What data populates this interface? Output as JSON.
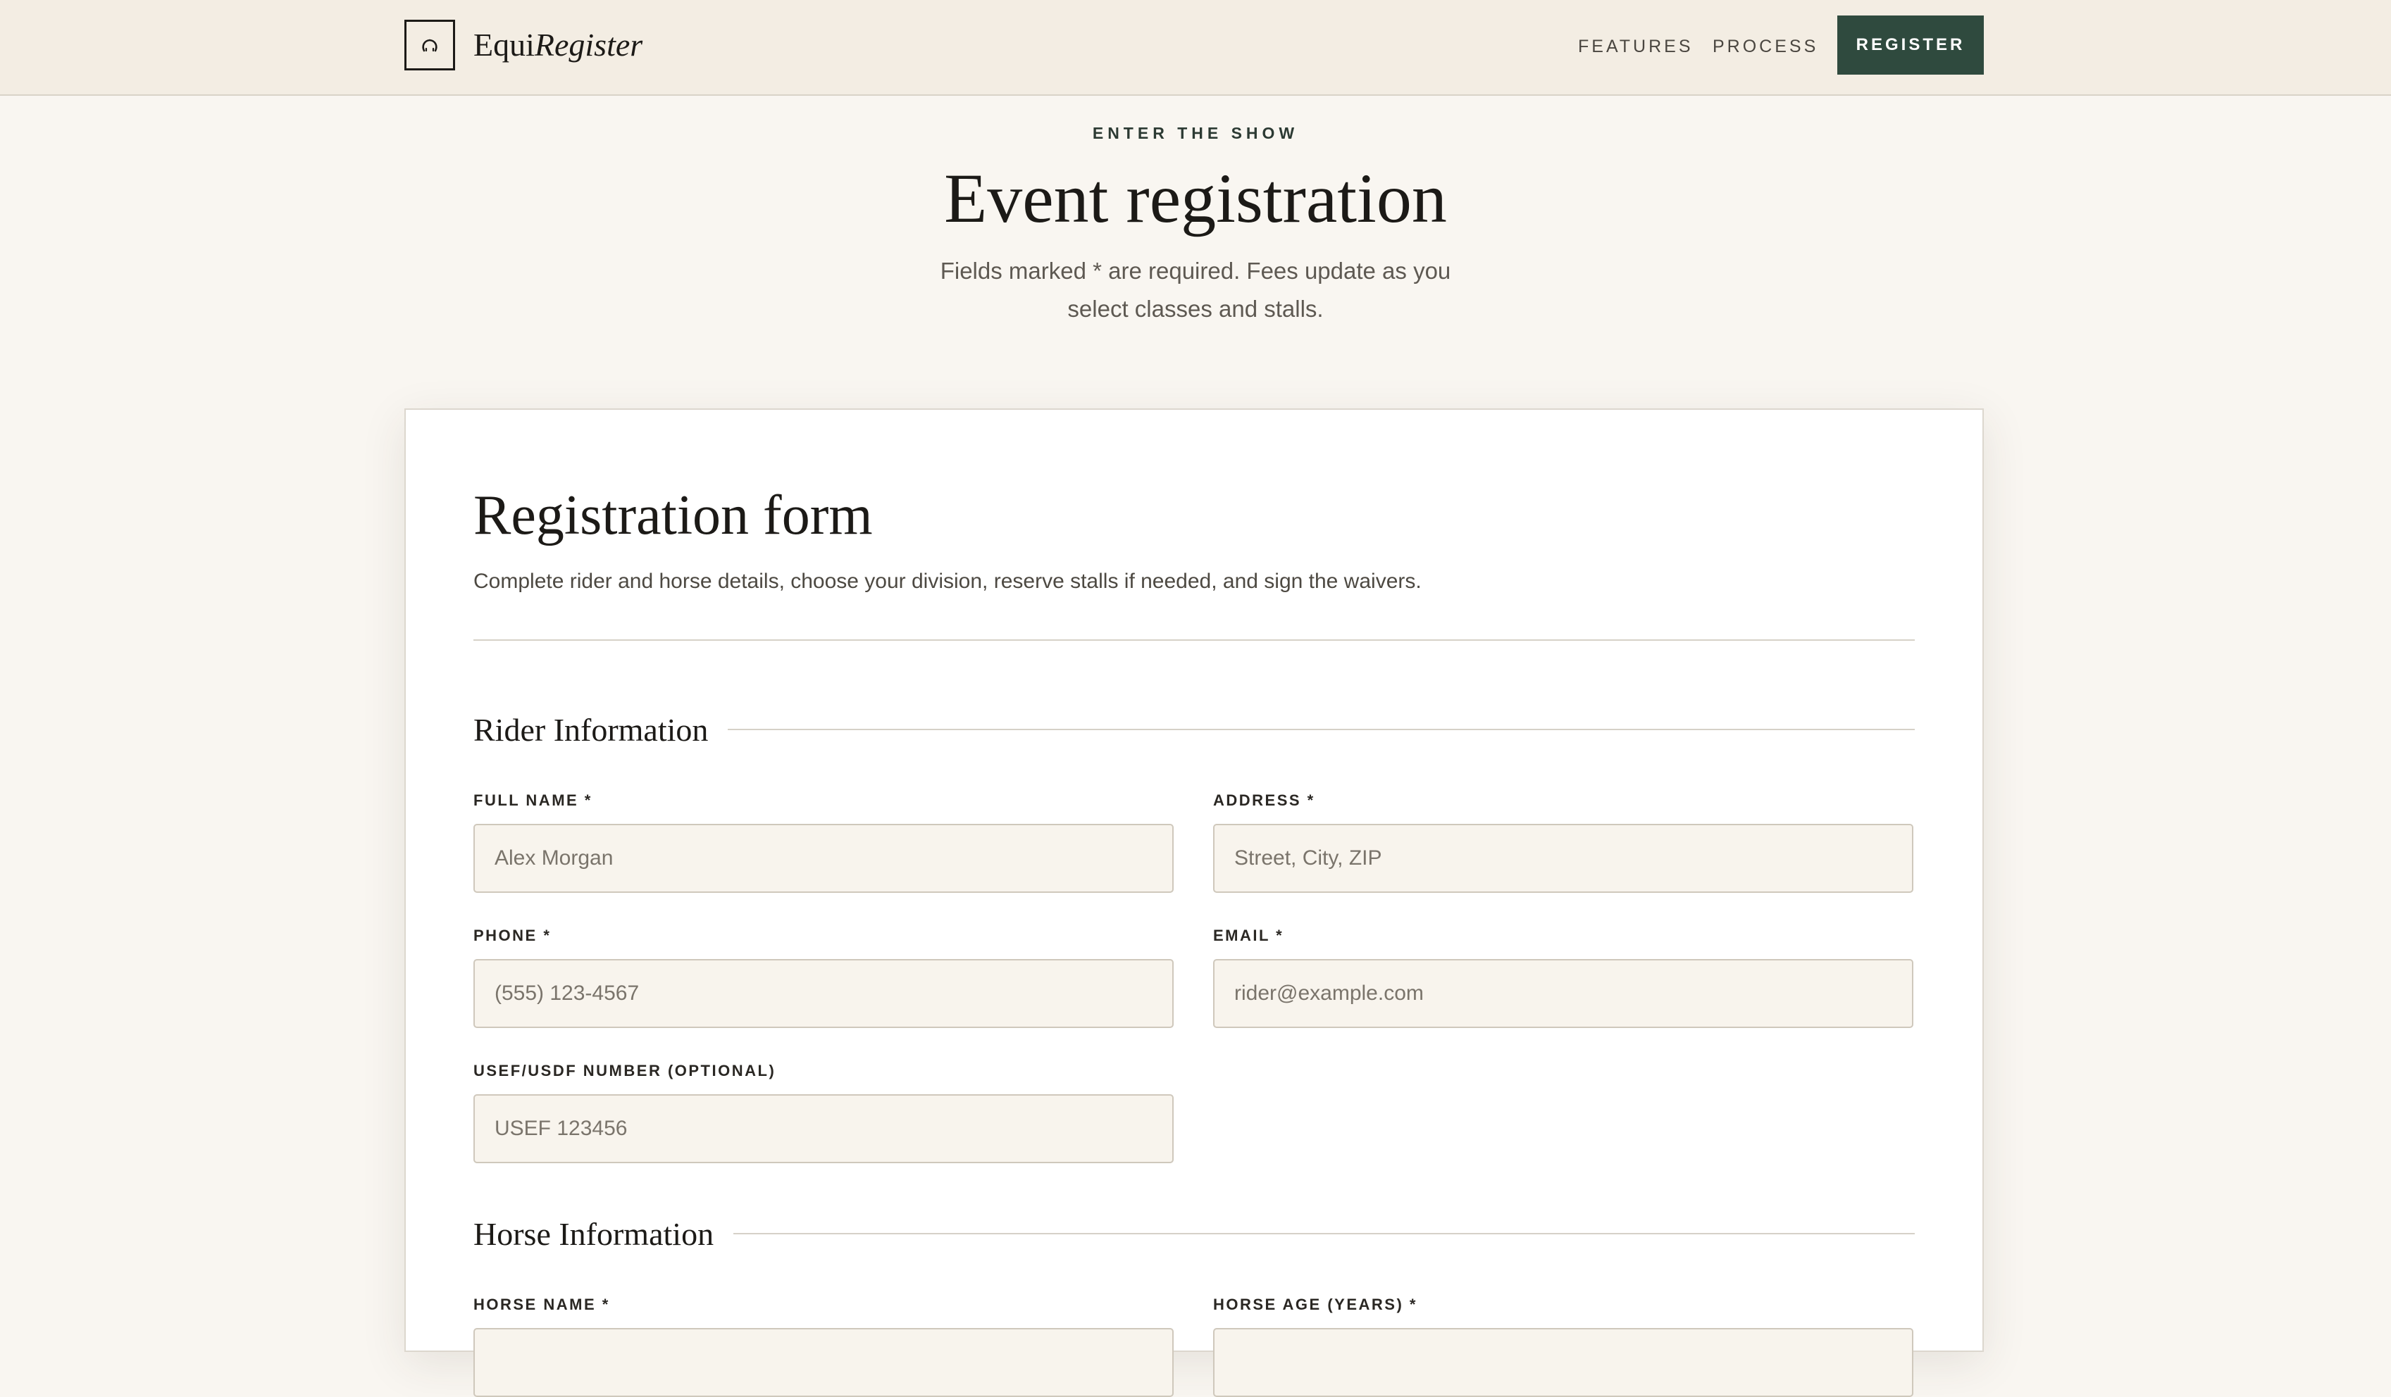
{
  "header": {
    "brand_plain": "Equi",
    "brand_italic": "Register",
    "nav": [
      {
        "label": "FEATURES"
      },
      {
        "label": "PROCESS"
      }
    ],
    "cta_label": "REGISTER"
  },
  "hero": {
    "eyebrow": "ENTER THE SHOW",
    "title": "Event registration",
    "subtitle": "Fields marked * are required. Fees update as you select classes and stalls."
  },
  "form": {
    "title": "Registration form",
    "description": "Complete rider and horse details, choose your division, reserve stalls if needed, and sign the waivers.",
    "sections": {
      "rider": {
        "title": "Rider Information",
        "fields": {
          "full_name": {
            "label": "FULL NAME *",
            "placeholder": "Alex Morgan"
          },
          "address": {
            "label": "ADDRESS *",
            "placeholder": "Street, City, ZIP"
          },
          "phone": {
            "label": "PHONE *",
            "placeholder": "(555) 123-4567"
          },
          "email": {
            "label": "EMAIL *",
            "placeholder": "rider@example.com"
          },
          "usef": {
            "label": "USEF/USDF NUMBER (OPTIONAL)",
            "placeholder": "USEF 123456"
          }
        }
      },
      "horse": {
        "title": "Horse Information",
        "fields": {
          "horse_name": {
            "label": "HORSE NAME *"
          },
          "horse_age": {
            "label": "HORSE AGE (YEARS) *"
          }
        }
      }
    }
  },
  "colors": {
    "accent": "#2f4a3e",
    "header_bg": "#f3ede3",
    "page_bg": "#f9f6f1",
    "input_bg": "#f8f4ed"
  },
  "icons": {
    "logo": "horseshoe-icon"
  }
}
